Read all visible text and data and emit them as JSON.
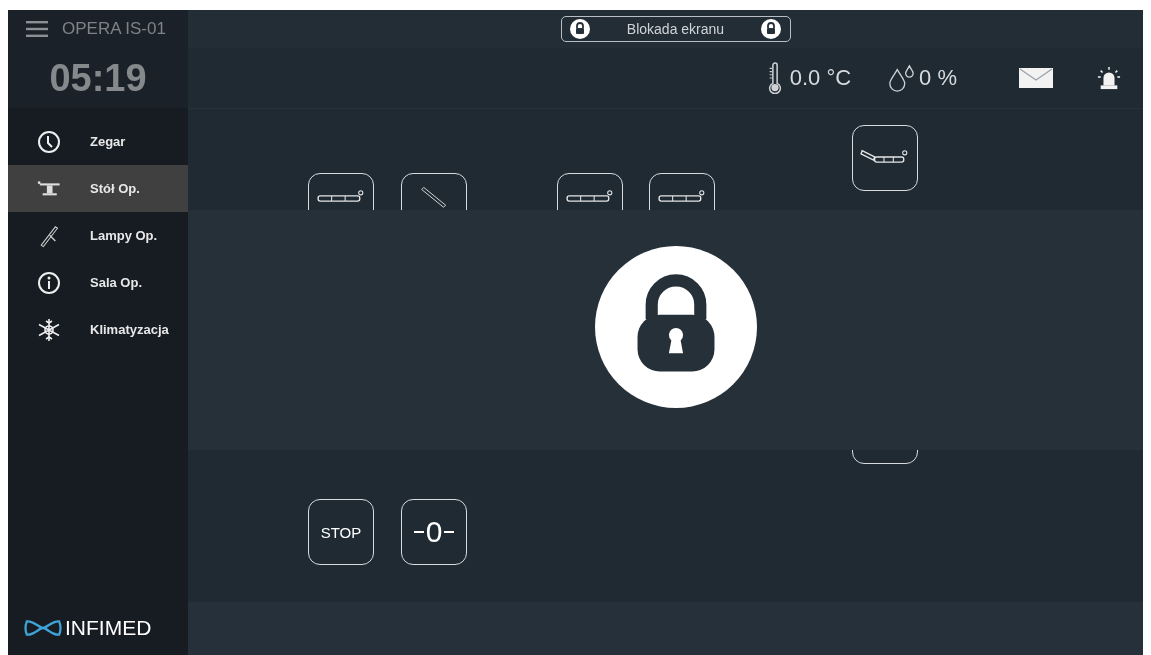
{
  "header": {
    "title": "OPERA IS-01",
    "lock_label": "Blokada ekranu"
  },
  "clock": "05:19",
  "sidebar": {
    "items": [
      {
        "label": "Zegar",
        "kind": "clock",
        "selected": false
      },
      {
        "label": "Stół Op.",
        "kind": "table",
        "selected": true
      },
      {
        "label": "Lampy Op.",
        "kind": "lamp",
        "selected": false
      },
      {
        "label": "Sala Op.",
        "kind": "info",
        "selected": false
      },
      {
        "label": "Klimatyzacja",
        "kind": "snow",
        "selected": false
      }
    ]
  },
  "logo": "INFIMED",
  "status": {
    "temperature": "0.0 °C",
    "humidity": "0 %"
  },
  "control_columns": [
    {
      "buttons": [
        {
          "kind": "flat"
        },
        {
          "kind": "stop",
          "label": "STOP"
        }
      ]
    },
    {
      "buttons": [
        {
          "kind": "tilt"
        },
        {
          "kind": "zero",
          "label": "0"
        }
      ]
    },
    {
      "buttons": [
        {
          "kind": "flat"
        }
      ]
    },
    {
      "buttons": [
        {
          "kind": "flat"
        }
      ]
    },
    {
      "buttons": [
        {
          "kind": "back"
        },
        {
          "kind": "hidden"
        }
      ]
    }
  ],
  "screen_lock": {
    "locked": true
  }
}
